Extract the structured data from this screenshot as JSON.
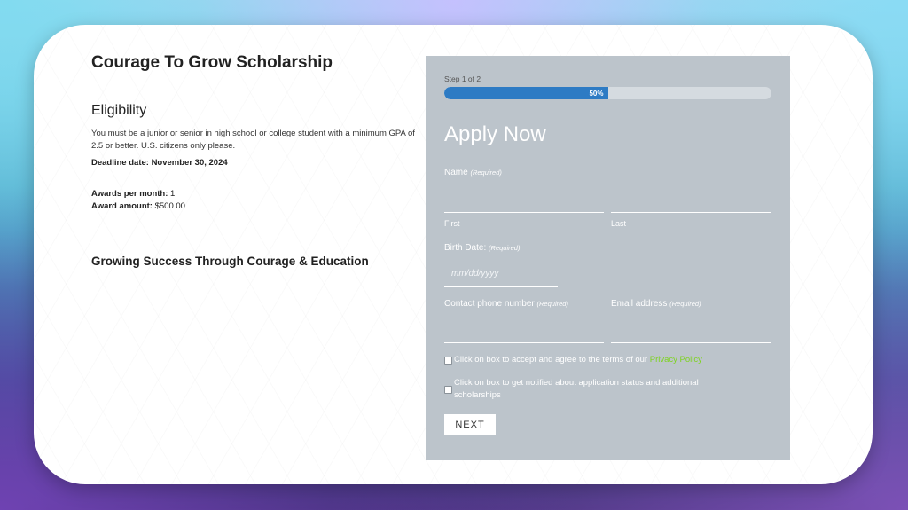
{
  "info": {
    "title": "Courage To Grow Scholarship",
    "eligibility_heading": "Eligibility",
    "eligibility_text": "You must be a junior or senior in high school or college student with a minimum GPA of 2.5 or better. U.S. citizens only please.",
    "deadline": "Deadline date: November 30, 2024",
    "awards_per_month_label": "Awards per month:",
    "awards_per_month_value": "1",
    "award_amount_label": "Award amount:",
    "award_amount_value": "$500.00",
    "tagline": "Growing Success Through Courage & Education"
  },
  "form": {
    "step_text": "Step 1 of 2",
    "progress_percent": 50,
    "progress_label": "50%",
    "heading": "Apply Now",
    "required_tag": "(Required)",
    "name_label": "Name",
    "first_sublabel": "First",
    "last_sublabel": "Last",
    "birth_label": "Birth Date:",
    "birth_placeholder": "mm/dd/yyyy",
    "phone_label": "Contact phone number",
    "email_label": "Email address",
    "consent_text": "Click on box to accept and agree to the terms of our",
    "privacy_link": "Privacy Policy",
    "notify_text": "Click on box to get notified about application status and additional scholarships",
    "next_button": "NEXT"
  },
  "colors": {
    "panel_bg": "#bcc4cb",
    "progress_fill": "#2d7bc4",
    "link": "#7ed321"
  }
}
